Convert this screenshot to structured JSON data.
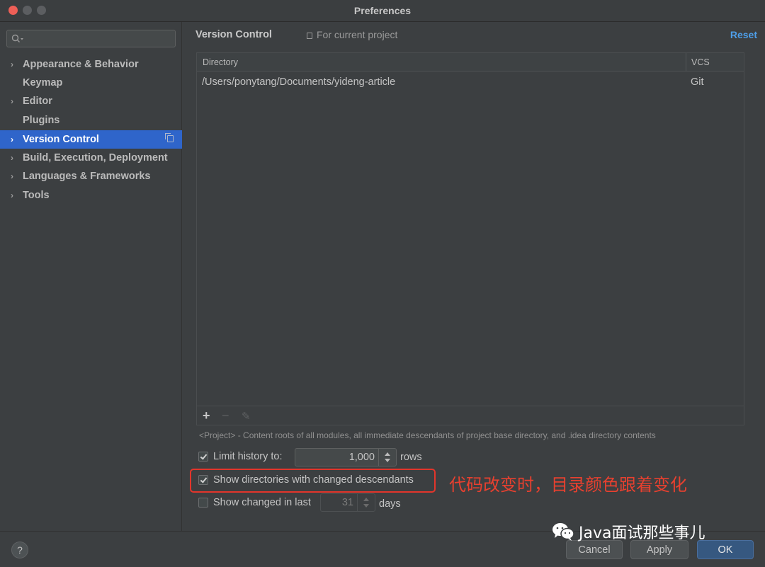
{
  "window": {
    "title": "Preferences"
  },
  "sidebar": {
    "search": {
      "value": "",
      "placeholder": ""
    },
    "items": [
      {
        "label": "Appearance & Behavior",
        "expandable": true,
        "selected": false
      },
      {
        "label": "Keymap",
        "expandable": false,
        "selected": false
      },
      {
        "label": "Editor",
        "expandable": true,
        "selected": false
      },
      {
        "label": "Plugins",
        "expandable": false,
        "selected": false
      },
      {
        "label": "Version Control",
        "expandable": true,
        "selected": true
      },
      {
        "label": "Build, Execution, Deployment",
        "expandable": true,
        "selected": false
      },
      {
        "label": "Languages & Frameworks",
        "expandable": true,
        "selected": false
      },
      {
        "label": "Tools",
        "expandable": true,
        "selected": false
      }
    ]
  },
  "header": {
    "title": "Version Control",
    "scope": "For current project",
    "reset_label": "Reset"
  },
  "table": {
    "columns": [
      "Directory",
      "VCS"
    ],
    "rows": [
      {
        "directory": "/Users/ponytang/Documents/yideng-article",
        "vcs": "Git"
      }
    ],
    "toolbar": {
      "add": "+",
      "remove": "−",
      "edit": "✎"
    }
  },
  "note": "<Project> - Content roots of all modules, all immediate descendants of project base directory, and .idea directory contents",
  "options": {
    "limit_history": {
      "label": "Limit history to:",
      "checked": true,
      "value": "1,000",
      "unit": "rows"
    },
    "show_dirs": {
      "label": "Show directories with changed descendants",
      "checked": true
    },
    "show_changed": {
      "label": "Show changed in last",
      "checked": false,
      "value": "31",
      "unit": "days"
    }
  },
  "annotation": "代码改变时，目录颜色跟着变化",
  "footer": {
    "help_label": "?",
    "cancel_label": "Cancel",
    "apply_label": "Apply",
    "ok_label": "OK"
  },
  "watermark": "Java面试那些事儿",
  "colors": {
    "selection": "#2f65ca",
    "link": "#4e9ee8",
    "annotation": "#e8402f",
    "ok_button": "#365880"
  }
}
